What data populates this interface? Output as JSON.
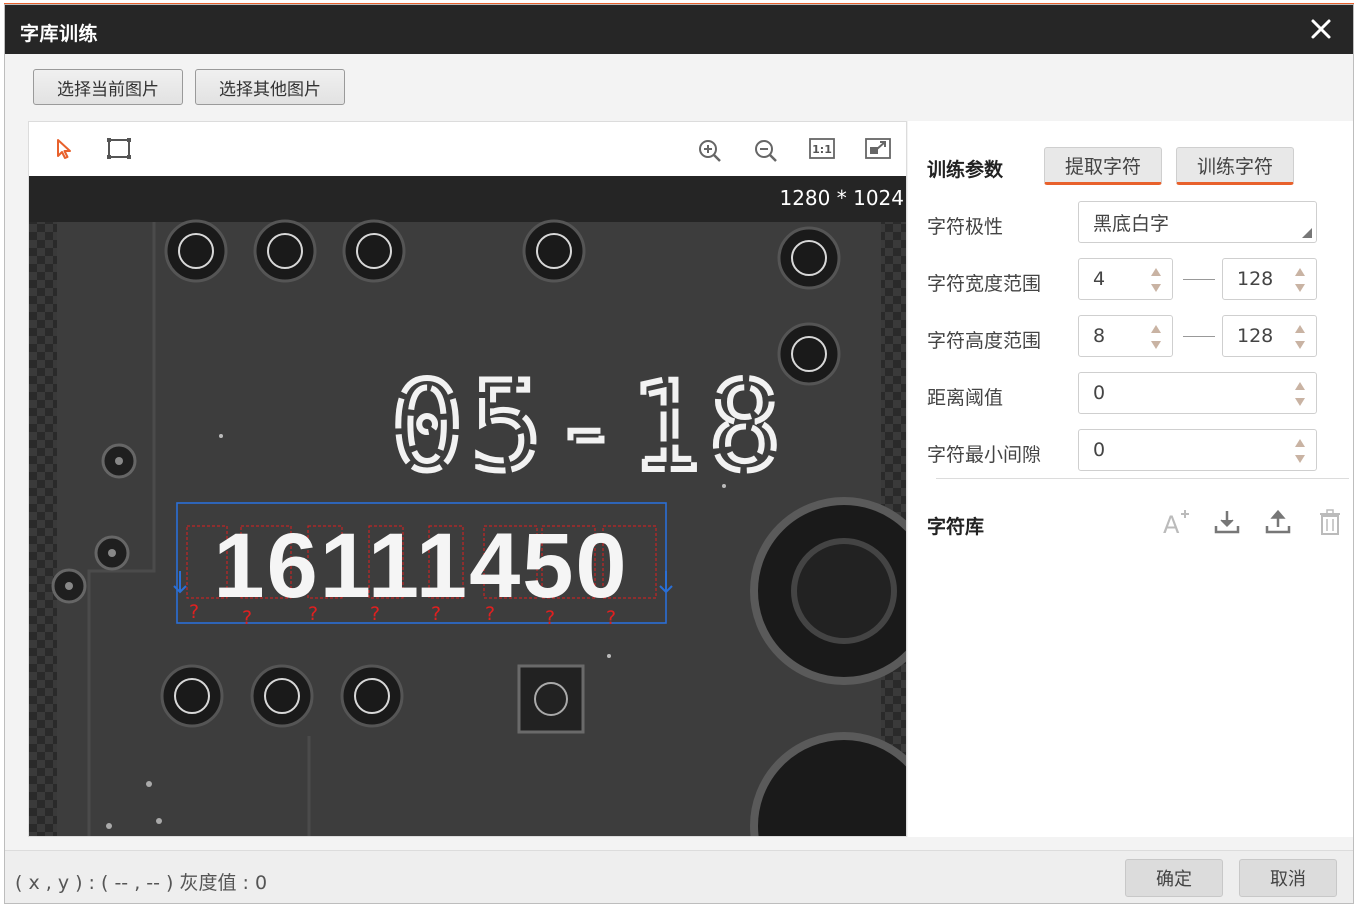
{
  "window": {
    "title": "字库训练",
    "close_icon": "close-icon"
  },
  "top_buttons": {
    "select_current": "选择当前图片",
    "select_other": "选择其他图片"
  },
  "toolbar": {
    "icons": [
      "arrow-select-icon",
      "rect-roi-icon",
      "zoom-in-icon",
      "zoom-out-icon",
      "actual-size-icon",
      "fit-window-icon"
    ],
    "actual_size_text": "1:1"
  },
  "image": {
    "resolution": "1280 * 1024",
    "printed_text_top": "05-18",
    "printed_text_bottom": "16111450",
    "unknown_marks": [
      "?",
      "?",
      "?",
      "?",
      "?",
      "?",
      "?",
      "?"
    ]
  },
  "params": {
    "title": "训练参数",
    "extract_button": "提取字符",
    "train_button": "训练字符",
    "polarity_label": "字符极性",
    "polarity_value": "黑底白字",
    "width_label": "字符宽度范围",
    "width_min": "4",
    "width_max": "128",
    "height_label": "字符高度范围",
    "height_min": "8",
    "height_max": "128",
    "distance_label": "距离阈值",
    "distance_value": "0",
    "gap_label": "字符最小间隙",
    "gap_value": "0"
  },
  "library": {
    "title": "字符库",
    "icons": [
      "add-char-icon",
      "import-icon",
      "export-icon",
      "delete-icon"
    ]
  },
  "status": {
    "coords": "( x , y ) :  ( -- , -- )  灰度值 : 0"
  },
  "footer": {
    "confirm": "确定",
    "cancel": "取消"
  },
  "colors": {
    "accent": "#e8612c",
    "titlebar": "#262626",
    "roi_box": "#2a6fd6",
    "unknown_mark": "#e02020"
  }
}
